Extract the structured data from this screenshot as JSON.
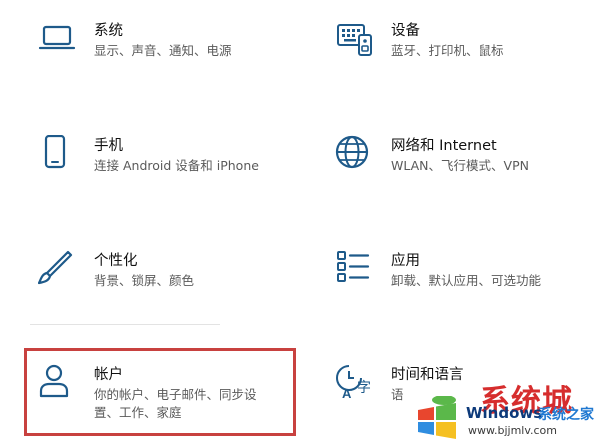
{
  "colors": {
    "icon": "#1e5a8a",
    "highlight_border": "#c8413f"
  },
  "tiles": [
    {
      "id": "system",
      "title": "系统",
      "desc": "显示、声音、通知、电源",
      "icon": "monitor-icon"
    },
    {
      "id": "devices",
      "title": "设备",
      "desc": "蓝牙、打印机、鼠标",
      "icon": "keyboard-icon"
    },
    {
      "id": "phone",
      "title": "手机",
      "desc": "连接 Android 设备和 iPhone",
      "icon": "phone-icon"
    },
    {
      "id": "network",
      "title": "网络和 Internet",
      "desc": "WLAN、飞行模式、VPN",
      "icon": "globe-icon"
    },
    {
      "id": "personal",
      "title": "个性化",
      "desc": "背景、锁屏、颜色",
      "icon": "brush-icon"
    },
    {
      "id": "apps",
      "title": "应用",
      "desc": "卸载、默认应用、可选功能",
      "icon": "apps-list-icon"
    },
    {
      "id": "accounts",
      "title": "帐户",
      "desc": "你的帐户、电子邮件、同步设",
      "desc2": "置、工作、家庭",
      "icon": "person-icon"
    },
    {
      "id": "time",
      "title": "时间和语言",
      "desc": "语",
      "icon": "time-language-icon"
    }
  ],
  "watermark": {
    "top_text": "系统城",
    "name": "Windows",
    "name_cn": "系统之家",
    "url": "www.bjjmlv.com"
  }
}
